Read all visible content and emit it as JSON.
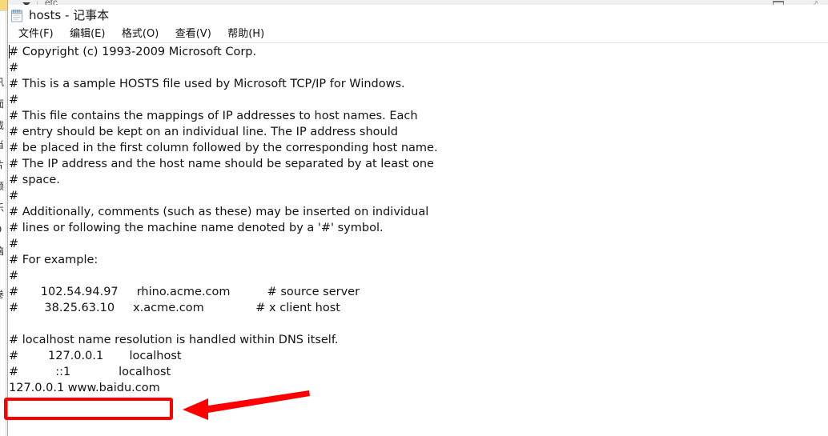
{
  "background_window": {
    "name": "explorer-strip",
    "breadcrumb": "etc",
    "dropdown_icon": "chevron-down-icon",
    "restore_button_icon": "restore-window-icon",
    "resize_grip_icon": "resize-grip-icon",
    "left_edge_labels": [
      "讯",
      "面",
      "载",
      "当",
      "片",
      "频",
      "乐",
      "D",
      "脑",
      "卷"
    ]
  },
  "notepad": {
    "icon": "notepad-icon",
    "title": "hosts - 记事本",
    "menu": [
      {
        "label": "文件(F)",
        "name": "menu-file"
      },
      {
        "label": "编辑(E)",
        "name": "menu-edit"
      },
      {
        "label": "格式(O)",
        "name": "menu-format"
      },
      {
        "label": "查看(V)",
        "name": "menu-view"
      },
      {
        "label": "帮助(H)",
        "name": "menu-help"
      }
    ],
    "document_lines": [
      "# Copyright (c) 1993-2009 Microsoft Corp.",
      "#",
      "# This is a sample HOSTS file used by Microsoft TCP/IP for Windows.",
      "#",
      "# This file contains the mappings of IP addresses to host names. Each",
      "# entry should be kept on an individual line. The IP address should",
      "# be placed in the first column followed by the corresponding host name.",
      "# The IP address and the host name should be separated by at least one",
      "# space.",
      "#",
      "# Additionally, comments (such as these) may be inserted on individual",
      "# lines or following the machine name denoted by a '#' symbol.",
      "#",
      "# For example:",
      "#",
      "#      102.54.94.97     rhino.acme.com          # source server",
      "#       38.25.63.10     x.acme.com              # x client host",
      "",
      "# localhost name resolution is handled within DNS itself.",
      "#        127.0.0.1       localhost",
      "#          ::1             localhost",
      "127.0.0.1 www.baidu.com",
      "",
      ""
    ]
  },
  "annotation": {
    "highlight_target_text": "127.0.0.1 www.baidu.com",
    "arrow_icon": "left-pointing-arrow-icon",
    "color": "#FE0000"
  }
}
